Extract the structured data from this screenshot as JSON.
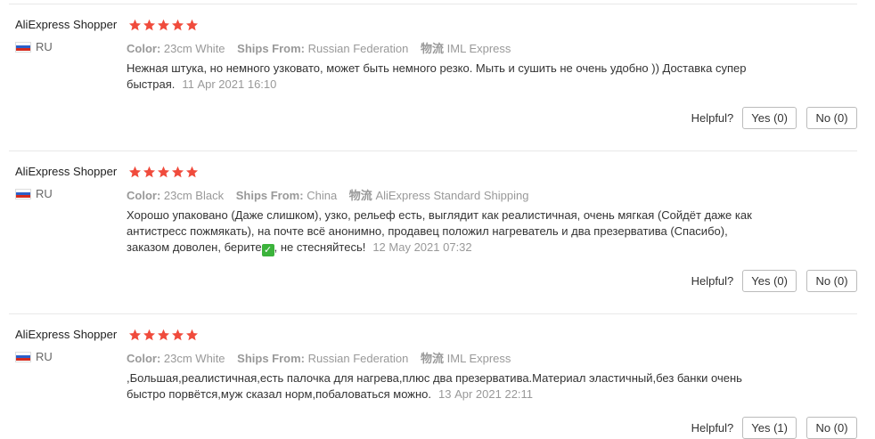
{
  "labels": {
    "color_key": "Color:",
    "ships_key": "Ships From:",
    "logistics_key": "物流",
    "helpful": "Helpful?"
  },
  "rating_color": "#f04b3c",
  "reviews": [
    {
      "user": "AliExpress Shopper",
      "stars": 5,
      "country": "RU",
      "color": "23cm White",
      "ships_from": "Russian Federation",
      "logistics": "IML Express",
      "text": "Нежная штука, но немного узковато, может быть немного резко. Мыть и сушить не очень удобно )) Доставка супер быстрая.",
      "date": "11 Apr 2021 16:10",
      "yes": "Yes (0)",
      "no": "No (0)"
    },
    {
      "user": "AliExpress Shopper",
      "stars": 5,
      "country": "RU",
      "color": "23cm Black",
      "ships_from": "China",
      "logistics": "AliExpress Standard Shipping",
      "text_before": "Хорошо упаковано (Даже слишком), узко, рельеф есть, выглядит как реалистичная, очень мягкая (Сойдёт даже как антистресс пожмякать), на почте всё анонимно, продавец положил нагреватель и два презерватива (Спасибо), заказом доволен, берите",
      "text_after": ", не стесняйтесь!",
      "date": "12 May 2021 07:32",
      "yes": "Yes (0)",
      "no": "No (0)"
    },
    {
      "user": "AliExpress Shopper",
      "stars": 5,
      "country": "RU",
      "color": "23cm White",
      "ships_from": "Russian Federation",
      "logistics": "IML Express",
      "text": ",Большая,реалистичная,есть палочка для нагрева,плюс два презерватива.Материал эластичный,без банки очень быстро порвётся,муж сказал норм,побаловаться можно.",
      "date": "13 Apr 2021 22:11",
      "yes": "Yes (1)",
      "no": "No (0)"
    }
  ]
}
